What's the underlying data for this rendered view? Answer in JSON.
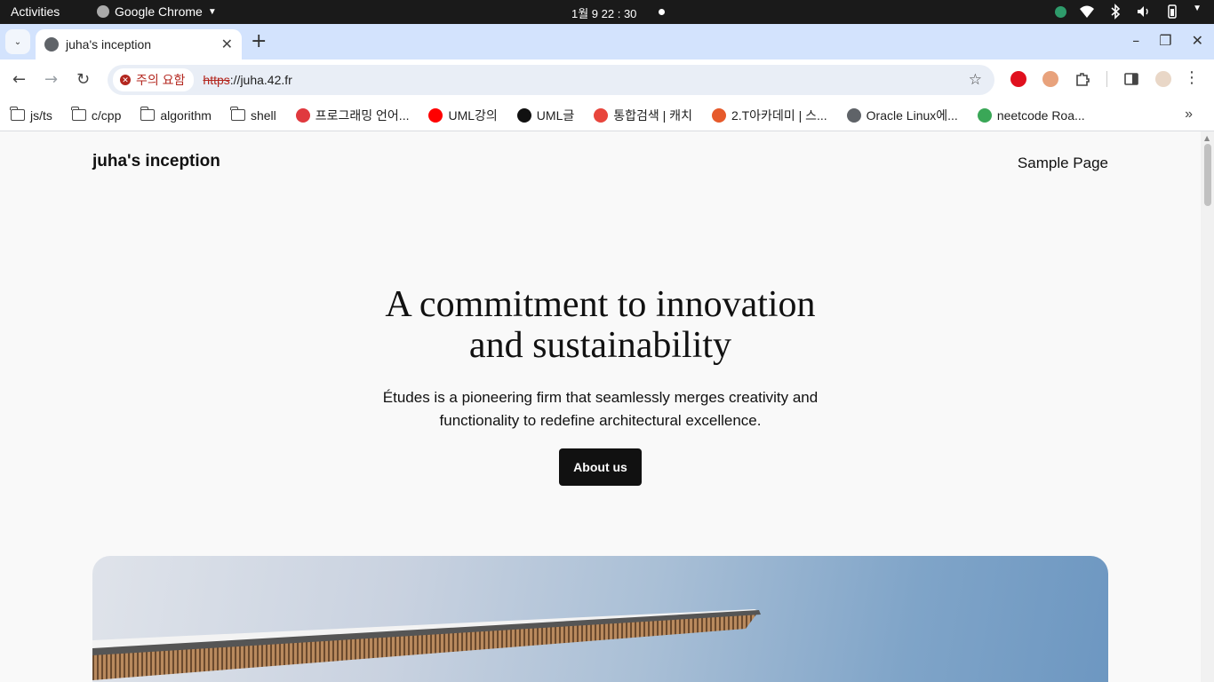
{
  "system_bar": {
    "activities": "Activities",
    "app_name": "Google Chrome",
    "clock": "1월 9  22 : 30"
  },
  "browser": {
    "tab_title": "juha's inception",
    "security_chip": "주의 요함",
    "url_scheme": "https",
    "url_rest": "://juha.42.fr",
    "bookmarks": [
      {
        "label": "js/ts",
        "icon": "folder-icon"
      },
      {
        "label": "c/cpp",
        "icon": "folder-icon"
      },
      {
        "label": "algorithm",
        "icon": "folder-icon"
      },
      {
        "label": "shell",
        "icon": "folder-icon"
      },
      {
        "label": "프로그래밍 언어...",
        "icon": "site-icon",
        "color": "#e0393e"
      },
      {
        "label": "UML강의",
        "icon": "youtube-icon",
        "color": "#ff0000"
      },
      {
        "label": "UML글",
        "icon": "site-icon",
        "color": "#111111"
      },
      {
        "label": "통합검색 | 캐치",
        "icon": "site-icon",
        "color": "#e8453c"
      },
      {
        "label": "2.T아카데미 | 스...",
        "icon": "site-icon",
        "color": "#e65a2b"
      },
      {
        "label": "Oracle Linux에...",
        "icon": "globe-icon",
        "color": "#5f6368"
      },
      {
        "label": "neetcode Roa...",
        "icon": "site-icon",
        "color": "#3aa757"
      }
    ]
  },
  "site": {
    "title": "juha's inception",
    "nav_item": "Sample Page",
    "hero_title_line1": "A commitment to innovation",
    "hero_title_line2": "and sustainability",
    "hero_subtitle": "Études is a pioneering firm that seamlessly merges creativity and functionality to redefine architectural excellence.",
    "cta_label": "About us"
  }
}
